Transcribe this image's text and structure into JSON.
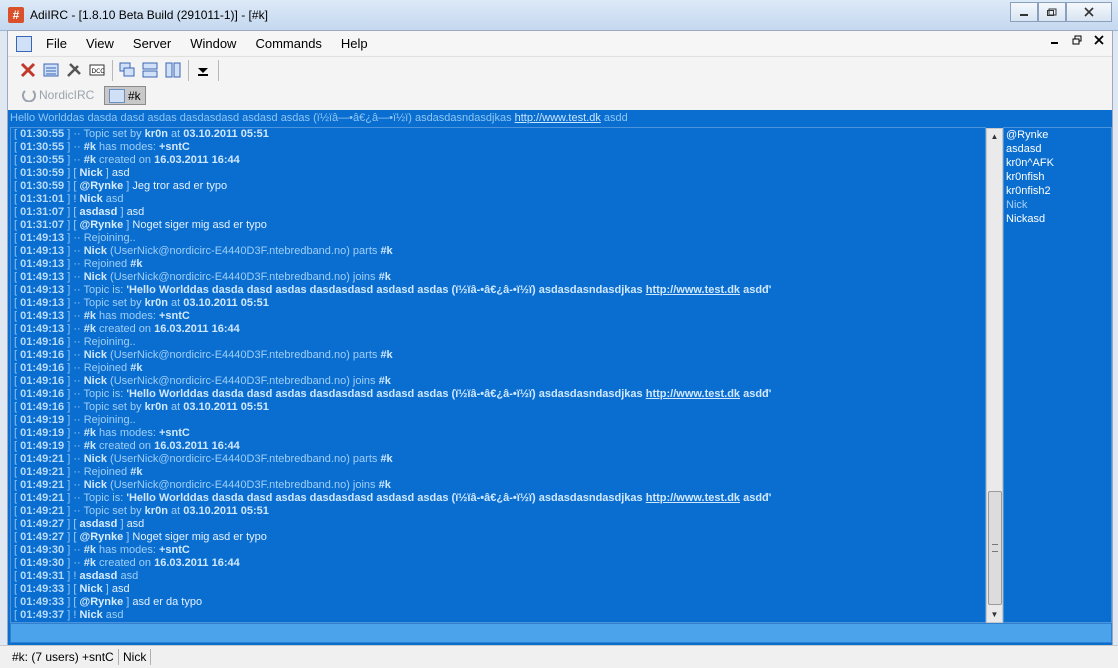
{
  "window": {
    "title": "AdiIRC - [1.8.10 Beta Build (291011-1)] - [#k]",
    "app_icon": "#"
  },
  "menubar": {
    "items": [
      "File",
      "View",
      "Server",
      "Window",
      "Commands",
      "Help"
    ]
  },
  "switchbar": {
    "network": "NordicIRC",
    "channel": "#k"
  },
  "channel": {
    "topic_prefix": "Hello Worlddas dasda dasd asdas dasdasdasd asdasd asdas (ï½ïâ—•â€¿â—•ï½ï) asdasdasndasdjkas ",
    "topic_link": "http://www.test.dk",
    "topic_suffix": " asdd",
    "log": [
      {
        "ts": "01:30:55",
        "type": "sys",
        "parts": [
          {
            "c": "sys",
            "t": "Topic set by "
          },
          {
            "c": "bold",
            "t": "kr0n"
          },
          {
            "c": "sys",
            "t": " at "
          },
          {
            "c": "bold",
            "t": "03.10.2011 05:51"
          }
        ]
      },
      {
        "ts": "01:30:55",
        "type": "sys",
        "parts": [
          {
            "c": "bold",
            "t": "#k"
          },
          {
            "c": "sys",
            "t": " has modes: "
          },
          {
            "c": "bold",
            "t": "+sntC"
          }
        ]
      },
      {
        "ts": "01:30:55",
        "type": "sys",
        "parts": [
          {
            "c": "bold",
            "t": "#k"
          },
          {
            "c": "sys",
            "t": " created on "
          },
          {
            "c": "bold",
            "t": "16.03.2011 16:44"
          }
        ]
      },
      {
        "ts": "01:30:59",
        "type": "msg",
        "nick": "Nick",
        "text": "asd"
      },
      {
        "ts": "01:30:59",
        "type": "msg",
        "nick": "@Rynke",
        "text": "Jeg tror asd er typo"
      },
      {
        "ts": "01:31:01",
        "type": "action",
        "nick": "Nick",
        "text": "asd"
      },
      {
        "ts": "01:31:07",
        "type": "msg",
        "nick": "asdasd",
        "text": "asd"
      },
      {
        "ts": "01:31:07",
        "type": "msg",
        "nick": "@Rynke",
        "text": "Noget siger mig asd er typo"
      },
      {
        "ts": "01:49:13",
        "type": "sys",
        "parts": [
          {
            "c": "sys",
            "t": "Rejoining.."
          }
        ]
      },
      {
        "ts": "01:49:13",
        "type": "sys",
        "parts": [
          {
            "c": "bold",
            "t": "Nick"
          },
          {
            "c": "sys",
            "t": " (UserNick@nordicirc-E4440D3F.ntebredband.no) parts "
          },
          {
            "c": "bold",
            "t": "#k"
          }
        ]
      },
      {
        "ts": "01:49:13",
        "type": "sys",
        "parts": [
          {
            "c": "sys",
            "t": "Rejoined "
          },
          {
            "c": "bold",
            "t": "#k"
          }
        ]
      },
      {
        "ts": "01:49:13",
        "type": "sys",
        "parts": [
          {
            "c": "bold",
            "t": "Nick"
          },
          {
            "c": "sys",
            "t": " (UserNick@nordicirc-E4440D3F.ntebredband.no) joins "
          },
          {
            "c": "bold",
            "t": "#k"
          }
        ]
      },
      {
        "ts": "01:49:13",
        "type": "sys",
        "parts": [
          {
            "c": "sys",
            "t": "Topic is: "
          },
          {
            "c": "bold",
            "t": "'Hello Worlddas dasda dasd asdas dasdasdasd asdasd asdas (ï½ïâ-•â€¿â-•ï½ï) asdasdasndasdjkas "
          },
          {
            "c": "link",
            "t": "http://www.test.dk"
          },
          {
            "c": "bold",
            "t": " asdđ'"
          }
        ]
      },
      {
        "ts": "01:49:13",
        "type": "sys",
        "parts": [
          {
            "c": "sys",
            "t": "Topic set by "
          },
          {
            "c": "bold",
            "t": "kr0n"
          },
          {
            "c": "sys",
            "t": " at "
          },
          {
            "c": "bold",
            "t": "03.10.2011 05:51"
          }
        ]
      },
      {
        "ts": "01:49:13",
        "type": "sys",
        "parts": [
          {
            "c": "bold",
            "t": "#k"
          },
          {
            "c": "sys",
            "t": " has modes: "
          },
          {
            "c": "bold",
            "t": "+sntC"
          }
        ]
      },
      {
        "ts": "01:49:13",
        "type": "sys",
        "parts": [
          {
            "c": "bold",
            "t": "#k"
          },
          {
            "c": "sys",
            "t": " created on "
          },
          {
            "c": "bold",
            "t": "16.03.2011 16:44"
          }
        ]
      },
      {
        "ts": "01:49:16",
        "type": "sys",
        "parts": [
          {
            "c": "sys",
            "t": "Rejoining.."
          }
        ]
      },
      {
        "ts": "01:49:16",
        "type": "sys",
        "parts": [
          {
            "c": "bold",
            "t": "Nick"
          },
          {
            "c": "sys",
            "t": " (UserNick@nordicirc-E4440D3F.ntebredband.no) parts "
          },
          {
            "c": "bold",
            "t": "#k"
          }
        ]
      },
      {
        "ts": "01:49:16",
        "type": "sys",
        "parts": [
          {
            "c": "sys",
            "t": "Rejoined "
          },
          {
            "c": "bold",
            "t": "#k"
          }
        ]
      },
      {
        "ts": "01:49:16",
        "type": "sys",
        "parts": [
          {
            "c": "bold",
            "t": "Nick"
          },
          {
            "c": "sys",
            "t": " (UserNick@nordicirc-E4440D3F.ntebredband.no) joins "
          },
          {
            "c": "bold",
            "t": "#k"
          }
        ]
      },
      {
        "ts": "01:49:16",
        "type": "sys",
        "parts": [
          {
            "c": "sys",
            "t": "Topic is: "
          },
          {
            "c": "bold",
            "t": "'Hello Worlddas dasda dasd asdas dasdasdasd asdasd asdas (ï½ïâ-•â€¿â-•ï½ï) asdasdasndasdjkas "
          },
          {
            "c": "link",
            "t": "http://www.test.dk"
          },
          {
            "c": "bold",
            "t": " asdđ'"
          }
        ]
      },
      {
        "ts": "01:49:16",
        "type": "sys",
        "parts": [
          {
            "c": "sys",
            "t": "Topic set by "
          },
          {
            "c": "bold",
            "t": "kr0n"
          },
          {
            "c": "sys",
            "t": " at "
          },
          {
            "c": "bold",
            "t": "03.10.2011 05:51"
          }
        ]
      },
      {
        "ts": "01:49:19",
        "type": "sys",
        "parts": [
          {
            "c": "sys",
            "t": "Rejoining.."
          }
        ]
      },
      {
        "ts": "01:49:19",
        "type": "sys",
        "parts": [
          {
            "c": "bold",
            "t": "#k"
          },
          {
            "c": "sys",
            "t": " has modes: "
          },
          {
            "c": "bold",
            "t": "+sntC"
          }
        ]
      },
      {
        "ts": "01:49:19",
        "type": "sys",
        "parts": [
          {
            "c": "bold",
            "t": "#k"
          },
          {
            "c": "sys",
            "t": " created on "
          },
          {
            "c": "bold",
            "t": "16.03.2011 16:44"
          }
        ]
      },
      {
        "ts": "01:49:21",
        "type": "sys",
        "parts": [
          {
            "c": "bold",
            "t": "Nick"
          },
          {
            "c": "sys",
            "t": " (UserNick@nordicirc-E4440D3F.ntebredband.no) parts "
          },
          {
            "c": "bold",
            "t": "#k"
          }
        ]
      },
      {
        "ts": "01:49:21",
        "type": "sys",
        "parts": [
          {
            "c": "sys",
            "t": "Rejoined "
          },
          {
            "c": "bold",
            "t": "#k"
          }
        ]
      },
      {
        "ts": "01:49:21",
        "type": "sys",
        "parts": [
          {
            "c": "bold",
            "t": "Nick"
          },
          {
            "c": "sys",
            "t": " (UserNick@nordicirc-E4440D3F.ntebredband.no) joins "
          },
          {
            "c": "bold",
            "t": "#k"
          }
        ]
      },
      {
        "ts": "01:49:21",
        "type": "sys",
        "parts": [
          {
            "c": "sys",
            "t": "Topic is: "
          },
          {
            "c": "bold",
            "t": "'Hello Worlddas dasda dasd asdas dasdasdasd asdasd asdas (ï½ïâ-•â€¿â-•ï½ï) asdasdasndasdjkas "
          },
          {
            "c": "link",
            "t": "http://www.test.dk"
          },
          {
            "c": "bold",
            "t": " asdđ'"
          }
        ]
      },
      {
        "ts": "01:49:21",
        "type": "sys",
        "parts": [
          {
            "c": "sys",
            "t": "Topic set by "
          },
          {
            "c": "bold",
            "t": "kr0n"
          },
          {
            "c": "sys",
            "t": " at "
          },
          {
            "c": "bold",
            "t": "03.10.2011 05:51"
          }
        ]
      },
      {
        "ts": "01:49:27",
        "type": "msg",
        "nick": "asdasd",
        "text": "asd"
      },
      {
        "ts": "01:49:27",
        "type": "msg",
        "nick": "@Rynke",
        "text": "Noget siger mig asd er typo"
      },
      {
        "ts": "01:49:30",
        "type": "sys",
        "parts": [
          {
            "c": "bold",
            "t": "#k"
          },
          {
            "c": "sys",
            "t": " has modes: "
          },
          {
            "c": "bold",
            "t": "+sntC"
          }
        ]
      },
      {
        "ts": "01:49:30",
        "type": "sys",
        "parts": [
          {
            "c": "bold",
            "t": "#k"
          },
          {
            "c": "sys",
            "t": " created on "
          },
          {
            "c": "bold",
            "t": "16.03.2011 16:44"
          }
        ]
      },
      {
        "ts": "01:49:31",
        "type": "action",
        "nick": "asdasd",
        "text": "asd"
      },
      {
        "ts": "01:49:33",
        "type": "msg",
        "nick": "Nick",
        "text": "asd"
      },
      {
        "ts": "01:49:33",
        "type": "msg",
        "nick": "@Rynke",
        "text": "asd er da typo"
      },
      {
        "ts": "01:49:37",
        "type": "action",
        "nick": "Nick",
        "text": "asd"
      }
    ],
    "nicklist": [
      {
        "name": "@Rynke",
        "away": false
      },
      {
        "name": "asdasd",
        "away": false
      },
      {
        "name": "kr0n^AFK",
        "away": false
      },
      {
        "name": "kr0nfish",
        "away": false
      },
      {
        "name": "kr0nfish2",
        "away": false
      },
      {
        "name": "Nick",
        "away": true
      },
      {
        "name": "Nickasd",
        "away": false
      }
    ]
  },
  "statusbar": {
    "channel_info": "#k: (7 users) +sntC",
    "nick": "Nick"
  }
}
